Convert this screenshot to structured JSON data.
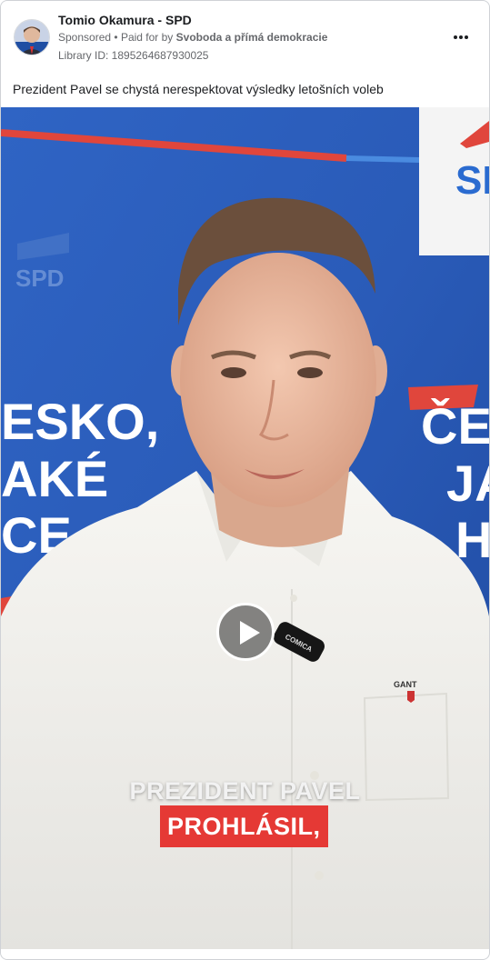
{
  "post": {
    "page_name": "Tomio Okamura - SPD",
    "sponsored": "Sponsored",
    "paid_for_prefix": "Paid for by",
    "paid_for_by": "Svoboda a přímá demokracie",
    "library_id": "Library ID: 1895264687930025",
    "caption": "Prezident Pavel se chystá nerespektovat výsledky letošních voleb",
    "more_icon": "more-horizontal-icon"
  },
  "video": {
    "subtitle_line1": "PREZIDENT PAVEL",
    "subtitle_line2": "PROHLÁSIL,",
    "backdrop_logo_small": "SPD",
    "backdrop_logo_large": "SP",
    "backdrop_left_lines": [
      "ESKO,",
      "AKÉ",
      "CE"
    ],
    "backdrop_right_lines": [
      "ČE",
      "JA",
      "HC"
    ],
    "mic_label": "COMICA",
    "shirt_logo": "GANT",
    "play_icon": "play-icon",
    "colors": {
      "backdrop_blue": "#2a5bb8",
      "accent_red": "#e53935",
      "shirt_white": "#f1f1ee"
    }
  }
}
